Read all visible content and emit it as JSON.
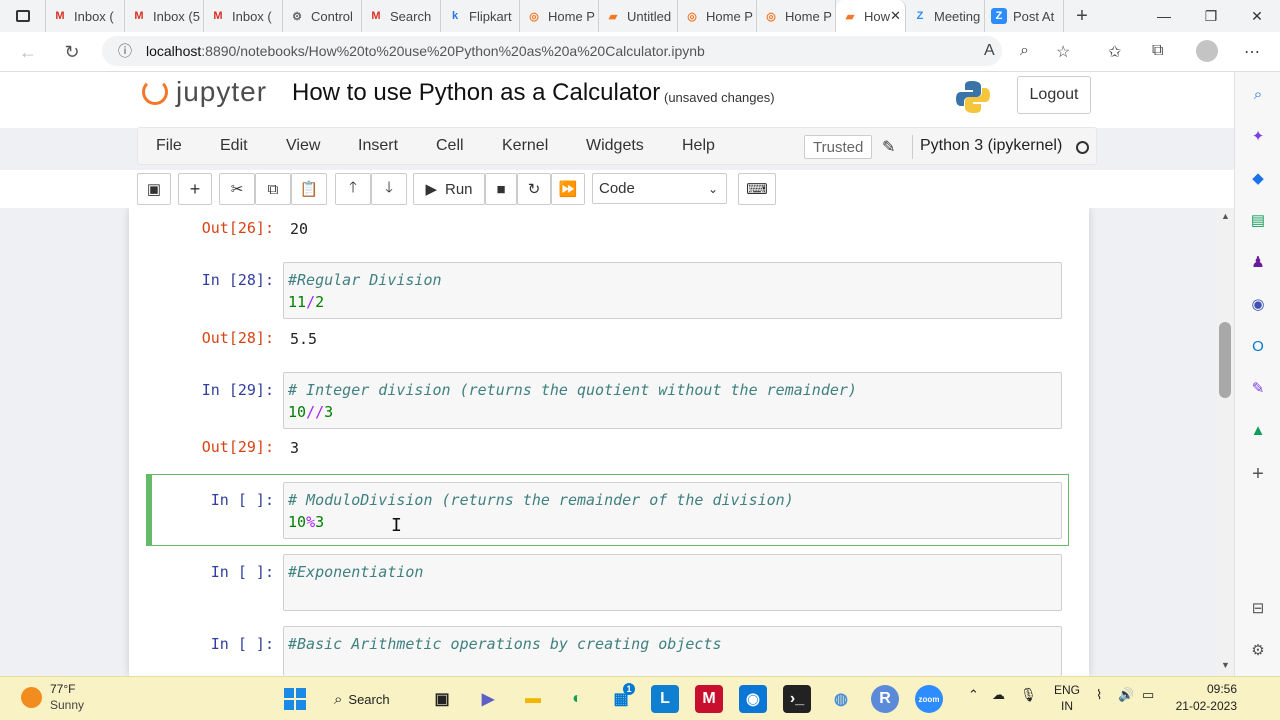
{
  "browser": {
    "tabs": [
      {
        "label": "Inbox (",
        "icon": "gmail-icon"
      },
      {
        "label": "Inbox (5",
        "icon": "gmail-icon"
      },
      {
        "label": "Inbox (",
        "icon": "gmail-icon"
      },
      {
        "label": "Control",
        "icon": "control-icon"
      },
      {
        "label": "Search",
        "icon": "gmail-icon"
      },
      {
        "label": "Flipkart",
        "icon": "flipkart-icon"
      },
      {
        "label": "Home P",
        "icon": "jupyter-icon"
      },
      {
        "label": "Untitled",
        "icon": "notebook-icon"
      },
      {
        "label": "Home P",
        "icon": "jupyter-icon"
      },
      {
        "label": "Home P",
        "icon": "jupyter-icon"
      },
      {
        "label": "How",
        "icon": "notebook-icon",
        "active": true
      },
      {
        "label": "Meeting",
        "icon": "zoom-icon"
      },
      {
        "label": "Post At",
        "icon": "zoom-icon"
      }
    ],
    "new_tab": "+",
    "url_host": "localhost",
    "url_path": ":8890/notebooks/How%20to%20use%20Python%20as%20a%20Calculator.ipynb"
  },
  "jupyter": {
    "logo_text": "jupyter",
    "notebook_title": "How to use Python as a Calculator",
    "save_status": "(unsaved changes)",
    "logout_label": "Logout",
    "menu": [
      "File",
      "Edit",
      "View",
      "Insert",
      "Cell",
      "Kernel",
      "Widgets",
      "Help"
    ],
    "trusted_label": "Trusted",
    "kernel_name": "Python 3 (ipykernel)",
    "run_label": "Run",
    "cell_type": "Code"
  },
  "cells": [
    {
      "type": "output",
      "prompt": "Out[26]:",
      "text": "20"
    },
    {
      "type": "input",
      "prompt": "In [28]:",
      "comment": "#Regular Division",
      "code": [
        "11",
        "/",
        "2"
      ]
    },
    {
      "type": "output",
      "prompt": "Out[28]:",
      "text": "5.5"
    },
    {
      "type": "input",
      "prompt": "In [29]:",
      "comment": "# Integer division (returns the quotient without the remainder)",
      "code": [
        "10",
        "//",
        "3"
      ]
    },
    {
      "type": "output",
      "prompt": "Out[29]:",
      "text": "3"
    },
    {
      "type": "input",
      "prompt": "In [ ]:",
      "comment": "# ModuloDivision (returns the remainder of the division)",
      "code": [
        "10",
        "%",
        "3"
      ],
      "selected": true
    },
    {
      "type": "input",
      "prompt": "In [ ]:",
      "comment": "#Exponentiation"
    },
    {
      "type": "input",
      "prompt": "In [ ]:",
      "comment": "#Basic Arithmetic operations by creating objects"
    }
  ],
  "taskbar": {
    "temperature": "77°F",
    "condition": "Sunny",
    "search_label": "Search",
    "lang_1": "ENG",
    "lang_2": "IN",
    "time": "09:56",
    "date": "21-02-2023",
    "store_badge": "1"
  },
  "colors": {
    "jupyter_orange": "#f37726",
    "selected_cell_border": "#66bb6a",
    "prompt_in": "#303f9f",
    "prompt_out": "#d84315"
  }
}
